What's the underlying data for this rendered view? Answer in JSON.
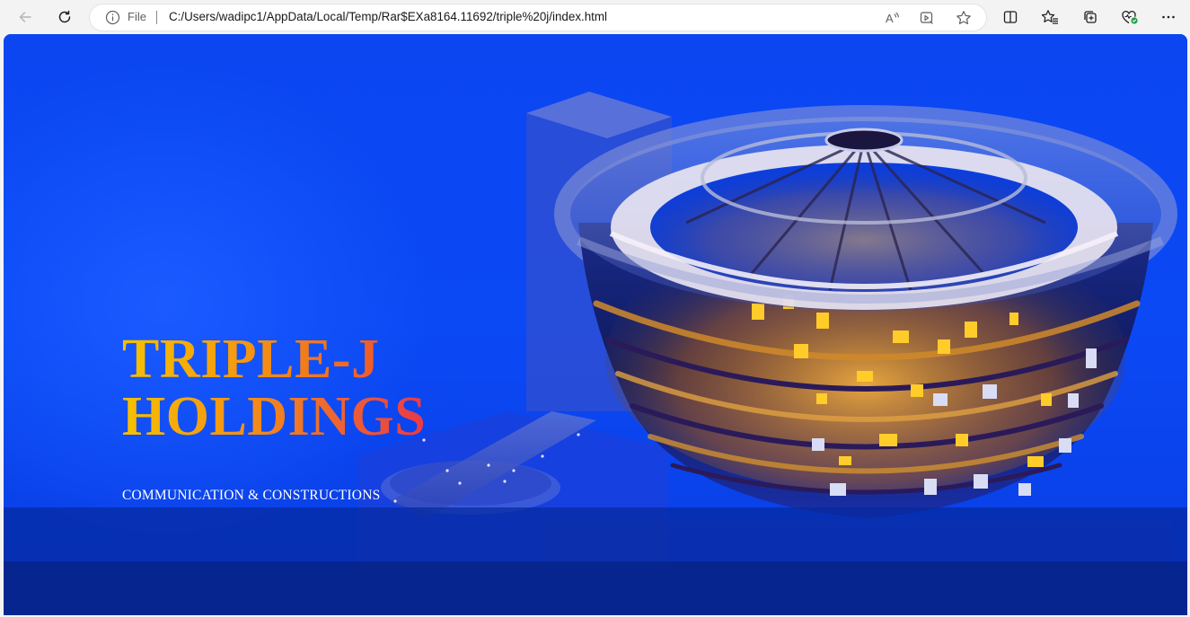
{
  "browser": {
    "address_prefix": "File",
    "url": "C:/Users/wadipc1/AppData/Local/Temp/Rar$EXa8164.11692/triple%20j/index.html",
    "toolbar_icons": [
      "back-icon",
      "refresh-icon",
      "info-icon",
      "read-aloud-icon",
      "app-available-icon",
      "favorite-star-icon",
      "split-screen-icon",
      "favorites-icon",
      "collections-icon",
      "browser-essentials-icon",
      "more-icon"
    ]
  },
  "page": {
    "brand_line1": "TRIPLE-J",
    "brand_line2": "HOLDINGS",
    "tagline": "COMMUNICATION & CONSTRUCTIONS"
  },
  "colors": {
    "hero_blue": "#0b49f5",
    "brand_gradient_start": "#f7c100",
    "brand_gradient_end": "#e83a4a",
    "footer_blue": "#06258f"
  }
}
